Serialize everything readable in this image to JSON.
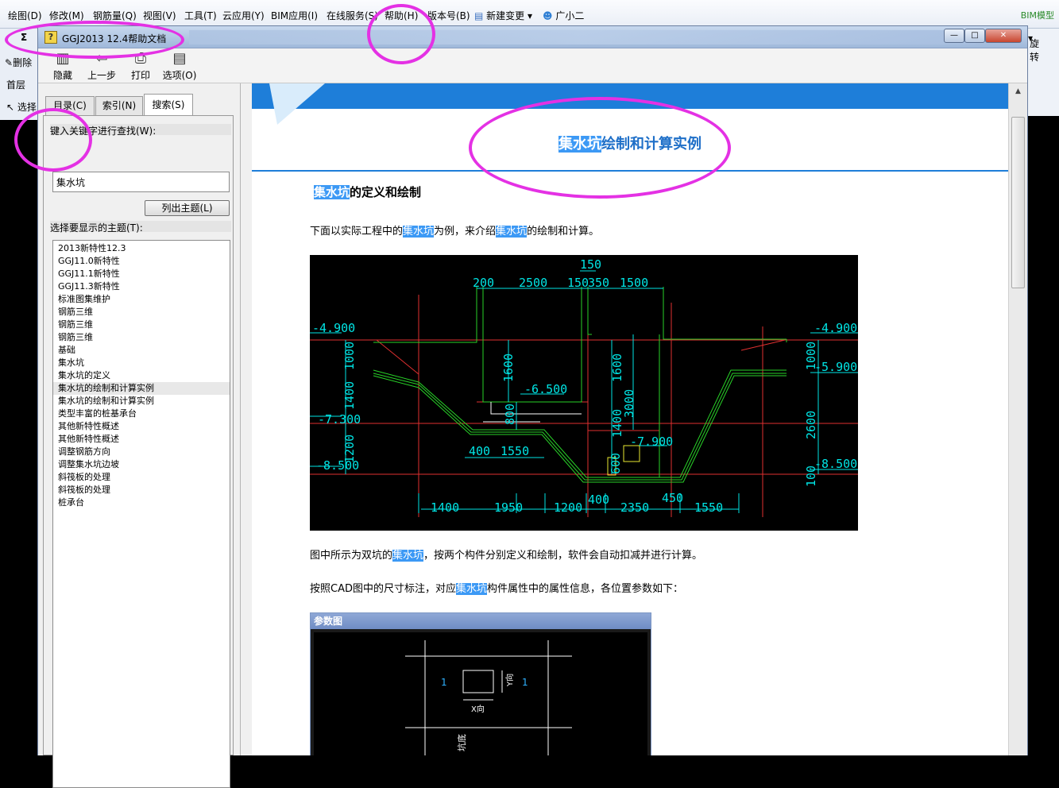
{
  "app_menu": {
    "items": [
      "绘图(D)",
      "修改(M)",
      "钢筋量(Q)",
      "视图(V)",
      "工具(T)",
      "云应用(Y)",
      "BIM应用(I)",
      "在线服务(S)",
      "帮助(H)",
      "版本号(B)",
      "新建变更",
      "广小二"
    ],
    "bim_label": "BIM模型",
    "rotate_label": "旋转",
    "left_tools": [
      "Σ",
      "删除",
      "首层",
      "选择"
    ]
  },
  "window": {
    "title": "GGJ2013 12.4帮助文档",
    "toolbar": [
      {
        "label": "隐藏",
        "icon": "hide-icon"
      },
      {
        "label": "上一步",
        "icon": "back-arrow-icon"
      },
      {
        "label": "打印",
        "icon": "printer-icon"
      },
      {
        "label": "选项(O)",
        "icon": "options-icon"
      }
    ]
  },
  "search_panel": {
    "tabs": [
      "目录(C)",
      "索引(N)",
      "搜索(S)"
    ],
    "active_tab": "搜索(S)",
    "keyword_label": "键入关键字进行查找(W):",
    "keyword_value": "集水坑",
    "list_button": "列出主题(L)",
    "topics_label": "选择要显示的主题(T):",
    "topics": [
      "2013新特性12.3",
      "GGJ11.0新特性",
      "GGJ11.1新特性",
      "GGJ11.3新特性",
      "标准图集维护",
      "钢筋三维",
      "钢筋三维",
      "钢筋三维",
      "基础",
      "集水坑",
      "集水坑的定义",
      "集水坑的绘制和计算实例",
      "集水坑的绘制和计算实例",
      "类型丰富的桩基承台",
      "其他新特性概述",
      "其他新特性概述",
      "调整钢筋方向",
      "调整集水坑边坡",
      "斜筏板的处理",
      "斜筏板的处理",
      "桩承台"
    ],
    "selected_topic_index": 11
  },
  "document": {
    "title_hl": "集水坑",
    "title_rest": "绘制和计算实例",
    "section_hl": "集水坑",
    "section_rest": "的定义和绘制",
    "p1": [
      "下面以实际工程中的",
      "集水坑",
      "为例，来介绍",
      "集水坑",
      "的绘制和计算。"
    ],
    "p2": [
      "图中所示为双坑的",
      "集水坑",
      "，按两个构件分别定义和绘制，软件会自动扣减并进行计算。"
    ],
    "p3": [
      "按照CAD图中的尺寸标注，对应",
      "集水坑",
      "构件属性中的属性信息，各位置参数如下："
    ],
    "highlight_color": "#3c99f5",
    "accent_color": "#1e7ed9"
  },
  "cad_drawing": {
    "top_dims": [
      "150",
      "200",
      "2500",
      "150",
      "350",
      "1500"
    ],
    "bottom_dims": [
      "1400",
      "1950",
      "1200",
      "400",
      "2350",
      "450",
      "1550"
    ],
    "left_levels": [
      "-4.900",
      "-7.300",
      "-8.500"
    ],
    "right_levels": [
      "-4.900",
      "-5.900",
      "-8.500"
    ],
    "inner_levels": [
      "-6.500",
      "-7.900"
    ],
    "left_vertical_dims": [
      "1000",
      "1400",
      "1200"
    ],
    "right_vertical_dims": [
      "1000",
      "2600",
      "100"
    ],
    "inner_vertical_dims": [
      "1600",
      "800",
      "1600",
      "3000",
      "1400",
      "600"
    ],
    "inner_horizontal_dims": [
      "400",
      "1550"
    ]
  },
  "param_figure": {
    "title": "参数图",
    "labels": [
      "1",
      "1",
      "Y向",
      "X向",
      "坑底"
    ]
  }
}
